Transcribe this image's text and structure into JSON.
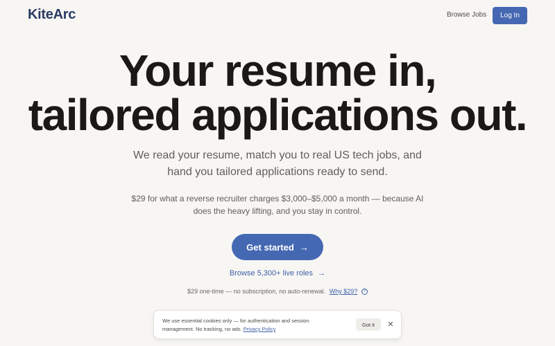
{
  "header": {
    "logo": "KiteArc",
    "nav": {
      "browse_jobs": "Browse Jobs",
      "login": "Log In"
    }
  },
  "hero": {
    "headline_line1": "Your resume in,",
    "headline_line2": "tailored applications out.",
    "subhead_line1": "We read your resume, match you to real US tech jobs, and",
    "subhead_line2": "hand you tailored applications ready to send.",
    "price_line1": "$29 for what a reverse recruiter charges $3,000–$5,000 a month — because AI",
    "price_line2": "does the heavy lifting, and you stay in control.",
    "cta_label": "Get started",
    "cta_arrow": "→",
    "browse_label": "Browse 5,300+ live roles",
    "browse_arrow": "→",
    "fine_print": "$29 one-time — no subscription, no auto-renewal.",
    "why_link": "Why $29?",
    "help_glyph": "?"
  },
  "cookie_banner": {
    "text_line1": "We use essential cookies only — for authentication and session",
    "text_line2": "management. No tracking, no ads.",
    "policy_link": "Privacy Policy",
    "got_it": "Got it",
    "close": "✕"
  },
  "colors": {
    "accent": "#4568b3",
    "background": "#f7f6f3",
    "headline": "#1a1918",
    "logo": "#2c3b66"
  }
}
